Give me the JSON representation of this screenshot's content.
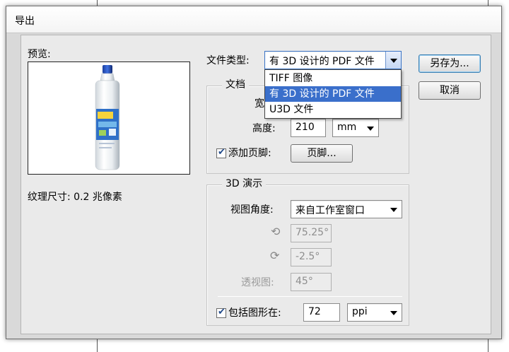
{
  "dialog": {
    "title": "导出"
  },
  "preview": {
    "label": "预览:",
    "texture_size": "纹理尺寸: 0.2 兆像素"
  },
  "file_type": {
    "label": "文件类型:",
    "selected": "有 3D 设计的 PDF 文件",
    "options": [
      "TIFF 图像",
      "有 3D 设计的 PDF 文件",
      "U3D 文件"
    ],
    "selected_index": 1
  },
  "buttons": {
    "save_as": "另存为...",
    "cancel": "取消",
    "footer": "页脚..."
  },
  "document": {
    "legend": "文档",
    "width_label": "宽",
    "height_label": "高度:",
    "height_value": "210",
    "unit": "mm",
    "add_footer_label": "添加页脚:",
    "add_footer_checked": true
  },
  "demo": {
    "legend": "3D 演示",
    "view_angle_label": "视图角度:",
    "view_angle_value": "来自工作室窗口",
    "rot_y_value": "75.25°",
    "rot_x_value": "-2.5°",
    "perspective_label": "透视图:",
    "perspective_value": "45°",
    "include_graphics_label": "包括图形在:",
    "include_graphics_checked": true,
    "resolution_value": "72",
    "resolution_unit": "ppi"
  },
  "icons": {
    "rotate_y": "vertical-axis-rotate-icon",
    "rotate_x": "horizontal-axis-rotate-icon"
  }
}
